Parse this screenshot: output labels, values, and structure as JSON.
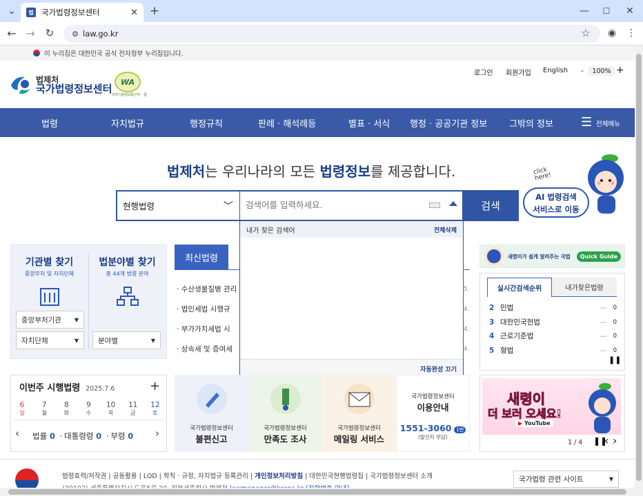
{
  "browser": {
    "tab_title": "국가법령정보센터",
    "tab_favicon": "법",
    "url": "law.go.kr"
  },
  "gov_banner": "이 누리집은 대한민국 공식 전자정부 누리집입니다.",
  "header": {
    "org": "법제처",
    "site": "국가법령정보센터",
    "login": "로그인",
    "signup": "회원가입",
    "english": "English",
    "zoom_minus": "-",
    "zoom": "100%",
    "zoom_plus": "+",
    "wa_mark": "WA",
    "wa_caption": "과학기술정보통신부 · 웹 접근성 인증"
  },
  "nav": {
    "items": [
      "법령",
      "자치법규",
      "행정규칙",
      "판례 · 해석례등",
      "별표 · 서식",
      "행정 · 공공기관 정보",
      "그밖의 정보"
    ],
    "all_menu": "전체메뉴"
  },
  "hero": {
    "strong1": "법제처",
    "text1": "는 우리나라의 모든 ",
    "strong2": "법령정보",
    "text2": "를 제공합니다."
  },
  "search": {
    "scope": "현행법령",
    "placeholder": "검색어를 입력하세요.",
    "button": "검색"
  },
  "dropdown": {
    "title": "내가 찾은 검색어",
    "delete_all": "전체삭제",
    "autocomplete_off": "자동완성 끄기"
  },
  "ai_banner": {
    "click": "click here!",
    "line1": "AI 법령검색",
    "line2": "서비스로 이동"
  },
  "finder": {
    "agency_title": "기관별 찾기",
    "agency_sub": "중앙부처 및 자치단체",
    "field_title": "법분야별 찾기",
    "field_sub": "총 44개 법령 분야",
    "select1": "중앙부처기관",
    "select2": "자치단체",
    "select3": "분야별"
  },
  "latest": {
    "tab": "최신법령",
    "items": [
      "수산생물질병 관리",
      "법인세법 시행규",
      "부가가치세법 시",
      "상속세 및 증여세"
    ],
    "dates": [
      "5.",
      "4.",
      "4.",
      "4."
    ]
  },
  "quick_guide": {
    "text": "새령이가 쉽게 알려주는 국법",
    "badge": "Quick Guide"
  },
  "rank": {
    "tab1": "실시간검색순위",
    "tab2": "내가찾은법령",
    "rows": [
      {
        "num": "2",
        "label": "민법",
        "val": "0"
      },
      {
        "num": "3",
        "label": "대한민국헌법",
        "val": "0"
      },
      {
        "num": "4",
        "label": "근로기준법",
        "val": "0"
      },
      {
        "num": "5",
        "label": "형법",
        "val": "0"
      }
    ],
    "pause": "❚❚"
  },
  "week": {
    "title": "이번주 시행법령",
    "date": "2025.7.6",
    "plus": "+",
    "days": [
      {
        "n": "6",
        "w": "일"
      },
      {
        "n": "7",
        "w": "월"
      },
      {
        "n": "8",
        "w": "화"
      },
      {
        "n": "9",
        "w": "수"
      },
      {
        "n": "10",
        "w": "목"
      },
      {
        "n": "11",
        "w": "금"
      },
      {
        "n": "12",
        "w": "토"
      }
    ],
    "law_label": "법률",
    "law_count": "0",
    "pres_label": "대통령령",
    "pres_count": "0",
    "min_label": "부령",
    "min_count": "0"
  },
  "services": [
    {
      "top": "국가법령정보센터",
      "main": "불편신고"
    },
    {
      "top": "국가법령정보센터",
      "main": "만족도 조사"
    },
    {
      "top": "국가법령정보센터",
      "main": "메일링 서비스"
    }
  ],
  "info": {
    "top": "국가법령정보센터",
    "main": "이용안내",
    "phone": "1551-3060",
    "ext": "1번",
    "note": "(발신자 부담)"
  },
  "promo": {
    "line1": "새령이",
    "line2": "더 보러 오세요!",
    "youtube": "YouTube",
    "page": "1 / 4"
  },
  "footer": {
    "links": [
      "법령효력/저작권",
      "공동활용",
      "LOD",
      "학칙 · 규정, 자치법규 등록관리",
      "개인정보처리방침",
      "대한민국현행법령집",
      "국가법령정보센터 소개"
    ],
    "sep": "|",
    "addr": "(30102) 세종특별자치시 도움5로 20, 정부세종청사 법제처",
    "email": "lawmanager@korea.kr",
    "num": "[전화번호 안내]",
    "related": "국가법령 관련 사이트"
  },
  "colors": {
    "nav": "#3a5aa8",
    "accent": "#2a56b6",
    "search_btn": "#2f55a4",
    "tab_active": "#3a62c0"
  }
}
